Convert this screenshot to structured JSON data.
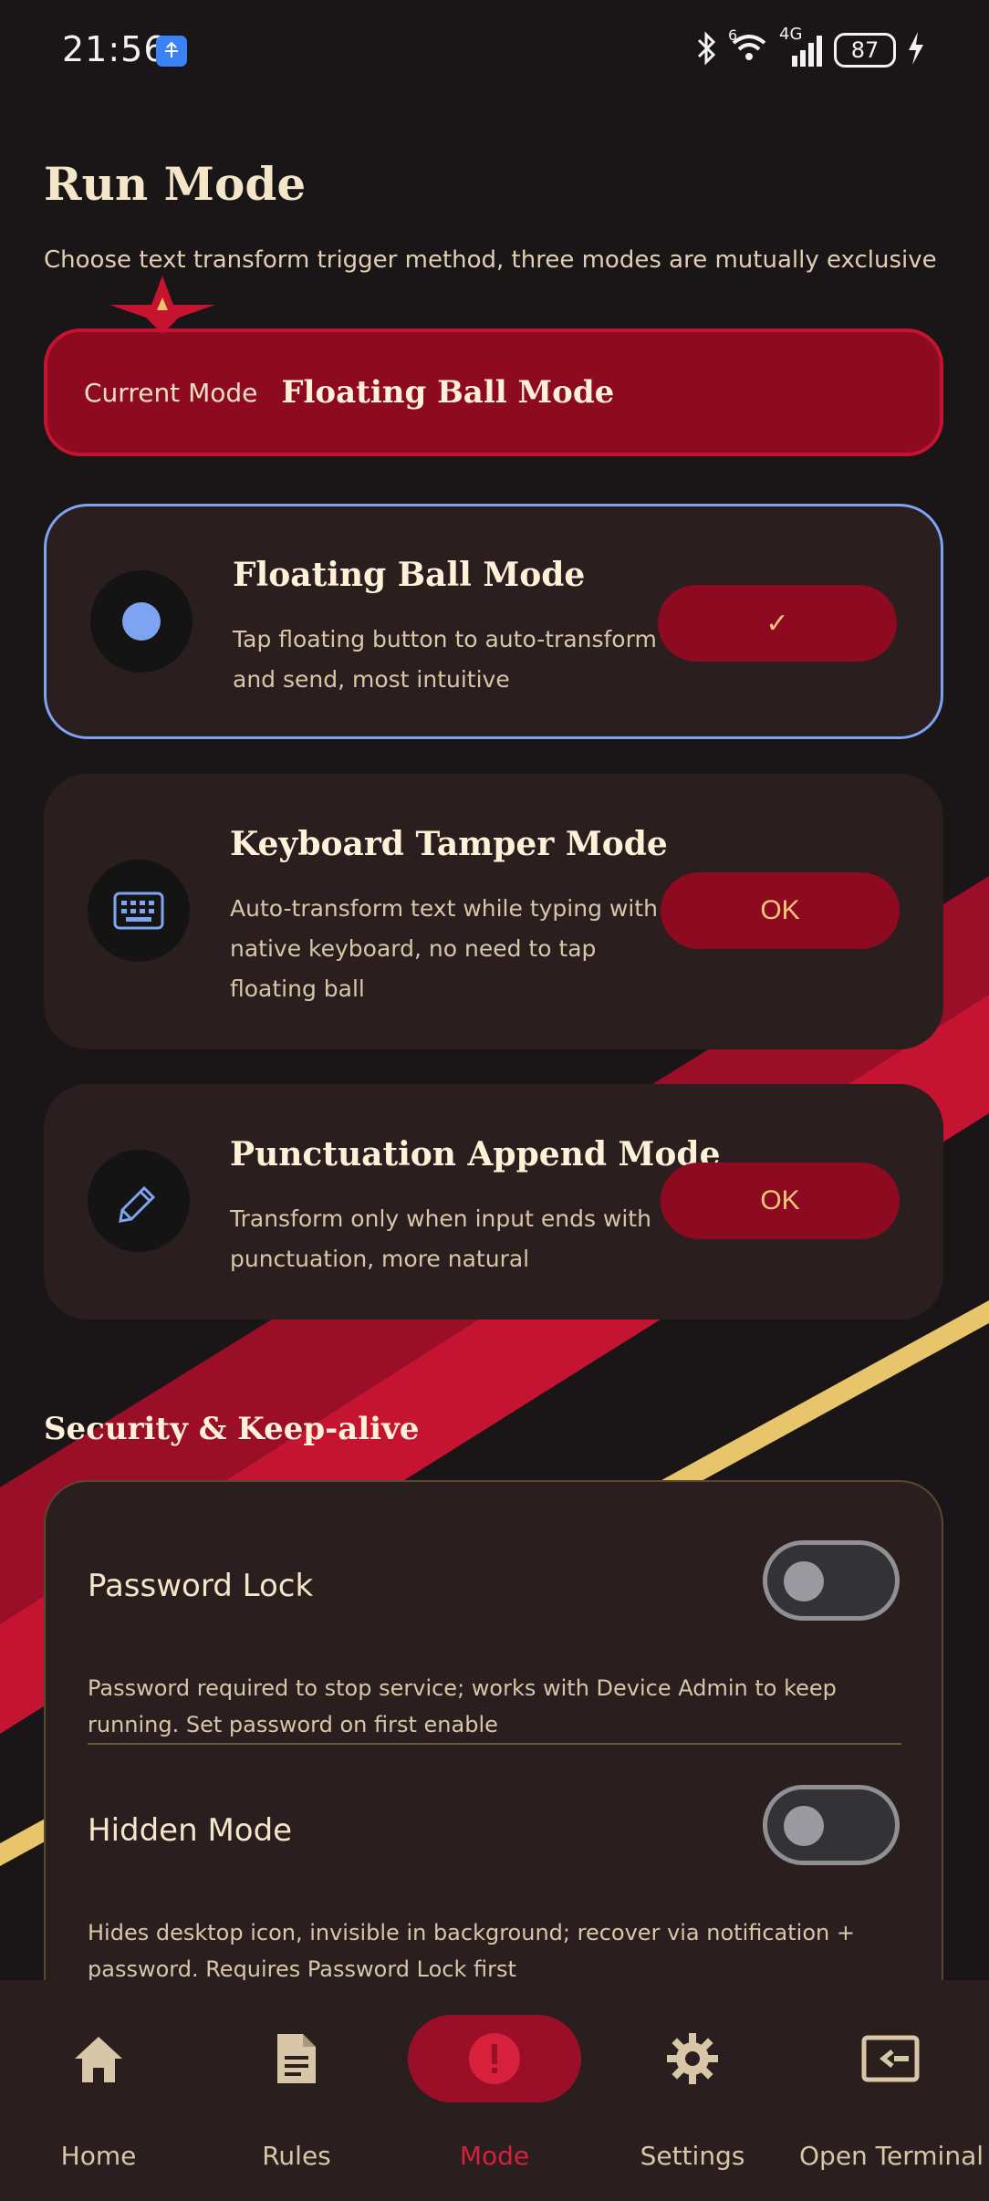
{
  "status_bar": {
    "time": "21:56",
    "battery": "87",
    "network_label": "4G",
    "wifi_badge": "6"
  },
  "page": {
    "title": "Run Mode",
    "subtitle": "Choose text transform trigger method, three modes are mutually exclusive"
  },
  "current_mode": {
    "label": "Current Mode",
    "value": "Floating Ball Mode"
  },
  "modes": [
    {
      "title": "Floating Ball Mode",
      "description": "Tap floating button to auto-transform and send, most intuitive",
      "button": "✓",
      "selected": true,
      "icon": "dot-icon"
    },
    {
      "title": "Keyboard Tamper Mode",
      "description": "Auto-transform text while typing with native keyboard, no need to tap floating ball",
      "button": "OK",
      "selected": false,
      "icon": "keyboard-icon"
    },
    {
      "title": "Punctuation Append Mode",
      "description": "Transform only when input ends with punctuation, more natural",
      "button": "OK",
      "selected": false,
      "icon": "pencil-icon"
    }
  ],
  "security": {
    "title": "Security & Keep-alive",
    "password_lock": {
      "title": "Password Lock",
      "description": "Password required to stop service; works with Device Admin to keep running. Set password on first enable",
      "enabled": false
    },
    "hidden_mode": {
      "title": "Hidden Mode",
      "description": "Hides desktop icon, invisible in background; recover via notification + password. Requires Password Lock first",
      "enabled": false
    }
  },
  "nav": {
    "items": [
      {
        "label": "Home",
        "icon": "home-icon"
      },
      {
        "label": "Rules",
        "icon": "document-icon"
      },
      {
        "label": "Mode",
        "icon": "alert-icon"
      },
      {
        "label": "Settings",
        "icon": "gear-icon"
      },
      {
        "label": "Open Terminal",
        "icon": "terminal-icon"
      }
    ],
    "active": "Mode"
  },
  "colors": {
    "background": "#1a1516",
    "card": "#2a1e1e",
    "accent_red": "#8e0a21",
    "accent_bright_red": "#c61430",
    "gold": "#e8c46a",
    "selected_border": "#7ea3f0"
  }
}
